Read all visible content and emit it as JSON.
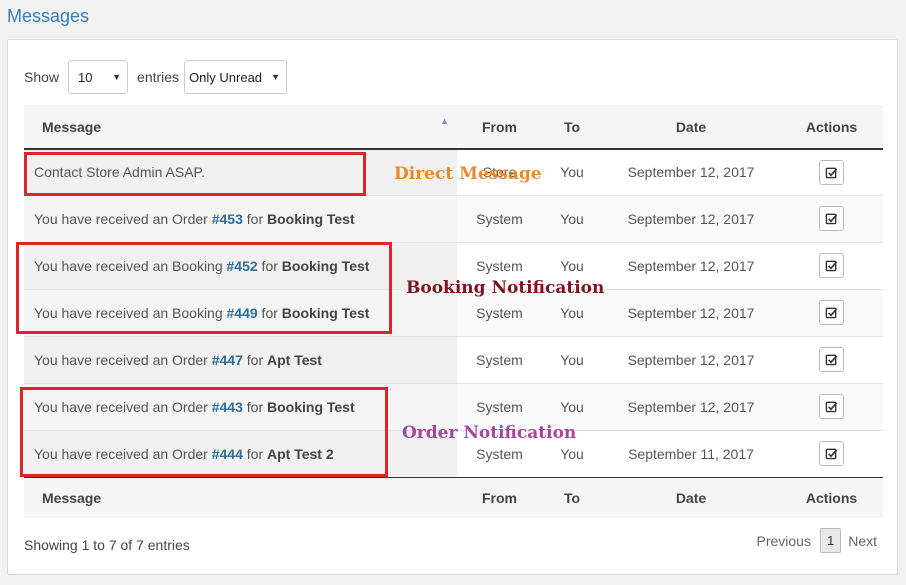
{
  "page": {
    "title": "Messages"
  },
  "controls": {
    "show_label": "Show",
    "entries_label": "entries",
    "page_length": "10",
    "filter": "Only Unread"
  },
  "table": {
    "columns": [
      "Message",
      "From",
      "To",
      "Date",
      "Actions"
    ],
    "rows": [
      {
        "text": "Contact Store Admin ASAP.",
        "from": "Store",
        "to": "You",
        "date": "September 12, 2017"
      },
      {
        "prefix": "You have received an Order ",
        "number": "#453",
        "mid": " for ",
        "item": "Booking Test",
        "from": "System",
        "to": "You",
        "date": "September 12, 2017"
      },
      {
        "prefix": "You have received an Booking ",
        "number": "#452",
        "mid": " for ",
        "item": "Booking Test",
        "from": "System",
        "to": "You",
        "date": "September 12, 2017"
      },
      {
        "prefix": "You have received an Booking ",
        "number": "#449",
        "mid": " for ",
        "item": "Booking Test",
        "from": "System",
        "to": "You",
        "date": "September 12, 2017"
      },
      {
        "prefix": "You have received an Order ",
        "number": "#447",
        "mid": " for ",
        "item": "Apt Test",
        "from": "System",
        "to": "You",
        "date": "September 12, 2017"
      },
      {
        "prefix": "You have received an Order ",
        "number": "#443",
        "mid": " for ",
        "item": "Booking Test",
        "from": "System",
        "to": "You",
        "date": "September 12, 2017"
      },
      {
        "prefix": "You have received an Order ",
        "number": "#444",
        "mid": " for ",
        "item": "Apt Test 2",
        "from": "System",
        "to": "You",
        "date": "September 11, 2017"
      }
    ]
  },
  "footer": {
    "info": "Showing 1 to 7 of 7 entries",
    "previous": "Previous",
    "current_page": "1",
    "next": "Next"
  },
  "annotations": {
    "direct": {
      "label": "Direct Message",
      "color": "#f0882a"
    },
    "booking": {
      "label": "Booking Notification",
      "color": "#7d1520"
    },
    "order": {
      "label": "Order Notification",
      "color": "#a3479e"
    },
    "box_color": "#e0222b"
  },
  "icons": {
    "sort": "sort-ascending-icon",
    "action": "check-square-icon"
  }
}
